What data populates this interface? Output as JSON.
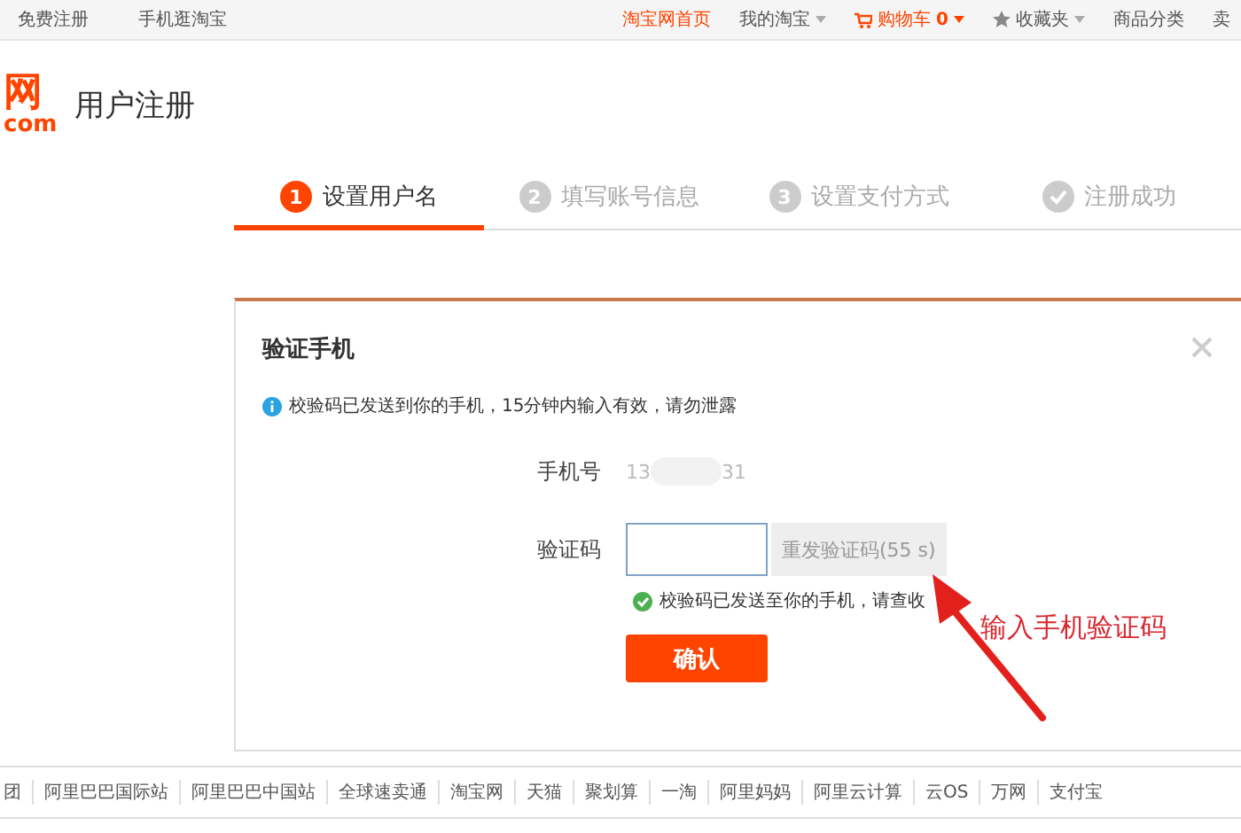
{
  "top_bar": {
    "left_links": [
      "免费注册",
      "手机逛淘宝"
    ],
    "right_links": [
      {
        "label": "淘宝网首页",
        "kind": "highlight"
      },
      {
        "label": "我的淘宝",
        "kind": "dropdown"
      },
      {
        "label": "购物车",
        "count": "0",
        "kind": "cart"
      },
      {
        "label": "收藏夹",
        "kind": "favorites"
      },
      {
        "label": "商品分类",
        "kind": "plain"
      },
      {
        "label": "卖",
        "kind": "plain"
      }
    ]
  },
  "header": {
    "logo_text": "网",
    "logo_domain": "com",
    "title": "用户注册"
  },
  "steps": [
    {
      "number": "1",
      "label": "设置用户名",
      "selected": true,
      "kind": "number"
    },
    {
      "number": "2",
      "label": "填写账号信息",
      "selected": false,
      "kind": "number"
    },
    {
      "number": "3",
      "label": "设置支付方式",
      "selected": false,
      "kind": "number"
    },
    {
      "label": "注册成功",
      "selected": false,
      "kind": "check"
    }
  ],
  "dialog": {
    "title": "验证手机",
    "info": "校验码已发送到你的手机，15分钟内输入有效，请勿泄露",
    "phone_label": "手机号",
    "phone_prefix": "13",
    "phone_suffix": "31",
    "code_label": "验证码",
    "resend_button": "重发验证码(55 s)",
    "resend_disabled": true,
    "success_hint": "校验码已发送至你的手机，请查收",
    "confirm_button": "确认"
  },
  "annotation": {
    "text": "输入手机验证码"
  },
  "footer_links": [
    "团",
    "阿里巴巴国际站",
    "阿里巴巴中国站",
    "全球速卖通",
    "淘宝网",
    "天猫",
    "聚划算",
    "一淘",
    "阿里妈妈",
    "阿里云计算",
    "云OS",
    "万网",
    "支付宝"
  ]
}
